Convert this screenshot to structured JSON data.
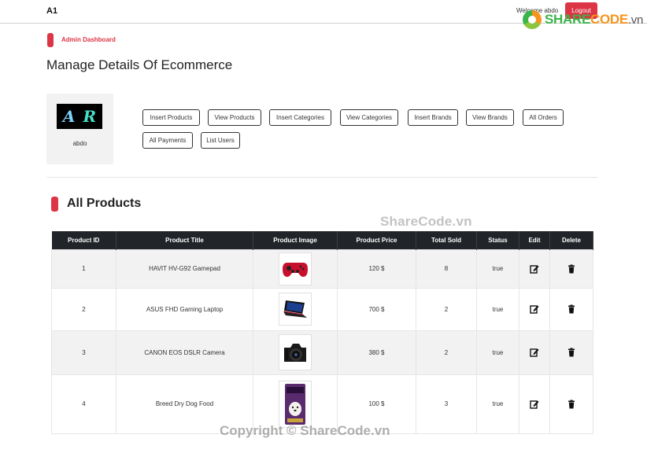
{
  "navbar": {
    "brand": "A1",
    "welcome": "Welcome abdo",
    "logout_label": "Logout"
  },
  "watermark": {
    "logo_share": "SHARE",
    "logo_code": "CODE",
    "logo_domain": ".vn",
    "center_text": "ShareCode.vn",
    "bottom_text": "Copyright © ShareCode.vn"
  },
  "dashboard": {
    "section_label": "Admin Dashboard",
    "page_title": "Manage Details Of Ecommerce",
    "profile": {
      "username": "abdo",
      "avatar_letters": [
        "A",
        "R"
      ]
    },
    "nav_buttons": [
      "Insert Products",
      "View Products",
      "Insert Categories",
      "View Categories",
      "Insert Brands",
      "View Brands",
      "All Orders",
      "All Payments",
      "List Users"
    ]
  },
  "products": {
    "title": "All Products",
    "columns": [
      "Product ID",
      "Product Title",
      "Product Image",
      "Product Price",
      "Total Sold",
      "Status",
      "Edit",
      "Delete"
    ],
    "rows": [
      {
        "id": "1",
        "title": "HAVIT HV-G92 Gamepad",
        "image": "gamepad-image",
        "price": "120 $",
        "sold": "8",
        "status": "true"
      },
      {
        "id": "2",
        "title": "ASUS FHD Gaming Laptop",
        "image": "laptop-image",
        "price": "700 $",
        "sold": "2",
        "status": "true"
      },
      {
        "id": "3",
        "title": "CANON EOS DSLR Camera",
        "image": "camera-image",
        "price": "380 $",
        "sold": "2",
        "status": "true"
      },
      {
        "id": "4",
        "title": "Breed Dry Dog Food",
        "image": "dog-food-image",
        "price": "100 $",
        "sold": "3",
        "status": "true"
      }
    ]
  },
  "colors": {
    "accent": "#dc3545",
    "table_header": "#212529",
    "row_alt": "#f2f2f2"
  },
  "icons": {
    "edit": "edit-icon",
    "delete": "trash-icon"
  }
}
